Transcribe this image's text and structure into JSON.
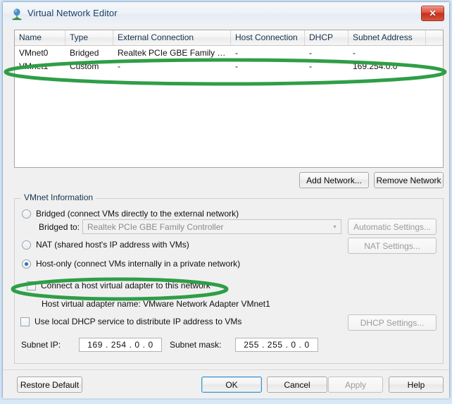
{
  "window": {
    "title": "Virtual Network Editor",
    "icon": "vmware-network-icon",
    "close_label": "✕"
  },
  "table": {
    "columns": [
      "Name",
      "Type",
      "External Connection",
      "Host Connection",
      "DHCP",
      "Subnet Address",
      ""
    ],
    "rows": [
      {
        "name": "VMnet0",
        "type": "Bridged",
        "external_connection": "Realtek PCIe GBE Family Co...",
        "host_connection": "-",
        "dhcp": "-",
        "subnet_address": "-",
        "extra": ""
      },
      {
        "name": "VMnet1",
        "type": "Custom",
        "external_connection": "-",
        "host_connection": "-",
        "dhcp": "-",
        "subnet_address": "169.254.0.0",
        "extra": ""
      }
    ]
  },
  "table_buttons": {
    "add_network": "Add Network...",
    "remove_network": "Remove Network"
  },
  "vmnet_information": {
    "legend": "VMnet Information",
    "bridged": {
      "label": "Bridged (connect VMs directly to the external network)",
      "selected": false
    },
    "bridged_to": {
      "label": "Bridged to:",
      "value": "Realtek PCIe GBE Family Controller",
      "arrow": "▾",
      "automatic_settings": "Automatic Settings..."
    },
    "nat": {
      "label": "NAT (shared host's IP address with VMs)",
      "selected": false,
      "settings": "NAT Settings..."
    },
    "host_only": {
      "label": "Host-only (connect VMs internally in a private network)",
      "selected": true
    },
    "connect_adapter": {
      "label": "Connect a host virtual adapter to this network",
      "checked": false
    },
    "adapter_name": "Host virtual adapter name: VMware Network Adapter VMnet1",
    "local_dhcp": {
      "label": "Use local DHCP service to distribute IP address to VMs",
      "checked": false,
      "settings": "DHCP Settings..."
    },
    "subnet_ip": {
      "label": "Subnet IP:",
      "value": "169 . 254 .  0  .  0"
    },
    "subnet_mask": {
      "label": "Subnet mask:",
      "value": "255 . 255 .  0  .  0"
    }
  },
  "footer": {
    "restore_default": "Restore Default",
    "ok": "OK",
    "cancel": "Cancel",
    "apply": "Apply",
    "help": "Help"
  },
  "annotations": {
    "color": "#2f9e46",
    "items": [
      {
        "name": "highlight-vmnet1-row"
      },
      {
        "name": "highlight-connect-adapter-checkbox"
      }
    ]
  }
}
